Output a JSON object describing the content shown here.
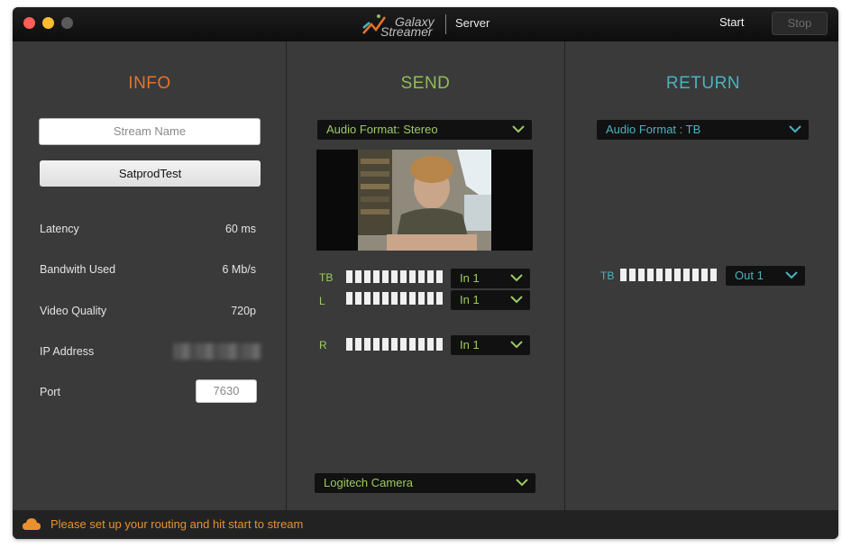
{
  "titlebar": {
    "logo_line1": "Galaxy",
    "logo_line2": "Streamer",
    "server_label": "Server",
    "start_label": "Start",
    "stop_label": "Stop"
  },
  "info": {
    "title": "INFO",
    "title_color": "#e5732c",
    "stream_name_placeholder": "Stream Name",
    "stream_name_button": "SatprodTest",
    "latency_label": "Latency",
    "latency_value": "60 ms",
    "bandwidth_label": "Bandwith Used",
    "bandwidth_value": "6 Mb/s",
    "quality_label": "Video Quality",
    "quality_value": "720p",
    "ip_label": "IP Address",
    "port_label": "Port",
    "port_value": "7630"
  },
  "send": {
    "title": "SEND",
    "title_color": "#8fbf54",
    "audio_format": "Audio Format: Stereo",
    "channels": [
      {
        "label": "TB",
        "input": "In 1"
      },
      {
        "label": "L",
        "input": "In 1"
      },
      {
        "label": "R",
        "input": "In 1"
      }
    ],
    "camera": "Logitech Camera"
  },
  "return": {
    "title": "RETURN",
    "title_color": "#4ab3bf",
    "audio_format": "Audio Format : TB",
    "channel_label": "TB",
    "output": "Out 1"
  },
  "status": {
    "message": "Please set up your routing and hit start to stream",
    "color": "#e8912e"
  }
}
